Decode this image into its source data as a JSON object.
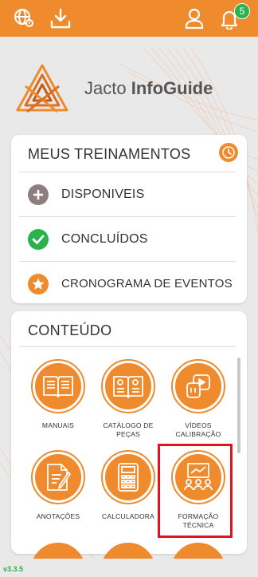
{
  "app": {
    "name_light": "Jacto ",
    "name_bold": "InfoGuide",
    "version": "v3.3.5",
    "accent_color": "#ef8a2d"
  },
  "topbar": {
    "icons": [
      "globe-location-icon",
      "download-icon",
      "user-icon",
      "bell-icon"
    ],
    "notification_count": "5"
  },
  "trainings": {
    "title": "MEUS TREINAMENTOS",
    "items": [
      {
        "label": "DISPONIVEIS",
        "icon": "plus-circle-icon",
        "color": "#8f7e7e"
      },
      {
        "label": "CONCLUÍDOS",
        "icon": "check-circle-icon",
        "color": "#2bb24c"
      },
      {
        "label": "CRONOGRAMA DE EVENTOS",
        "icon": "star-circle-icon",
        "color": "#ef8a2d"
      }
    ]
  },
  "content": {
    "title": "CONTEÚDO",
    "tiles": [
      {
        "label": "MANUAIS",
        "icon": "book-icon"
      },
      {
        "label": "CATÁLOGO DE\nPEÇAS",
        "icon": "catalog-icon"
      },
      {
        "label": "VÍDEOS\nCALIBRAÇÃO",
        "icon": "video-icon"
      },
      {
        "label": "ANOTAÇÕES",
        "icon": "notes-icon"
      },
      {
        "label": "CALCULADORA",
        "icon": "calculator-icon"
      },
      {
        "label": "FORMAÇÃO\nTÉCNICA",
        "icon": "training-icon"
      }
    ]
  }
}
